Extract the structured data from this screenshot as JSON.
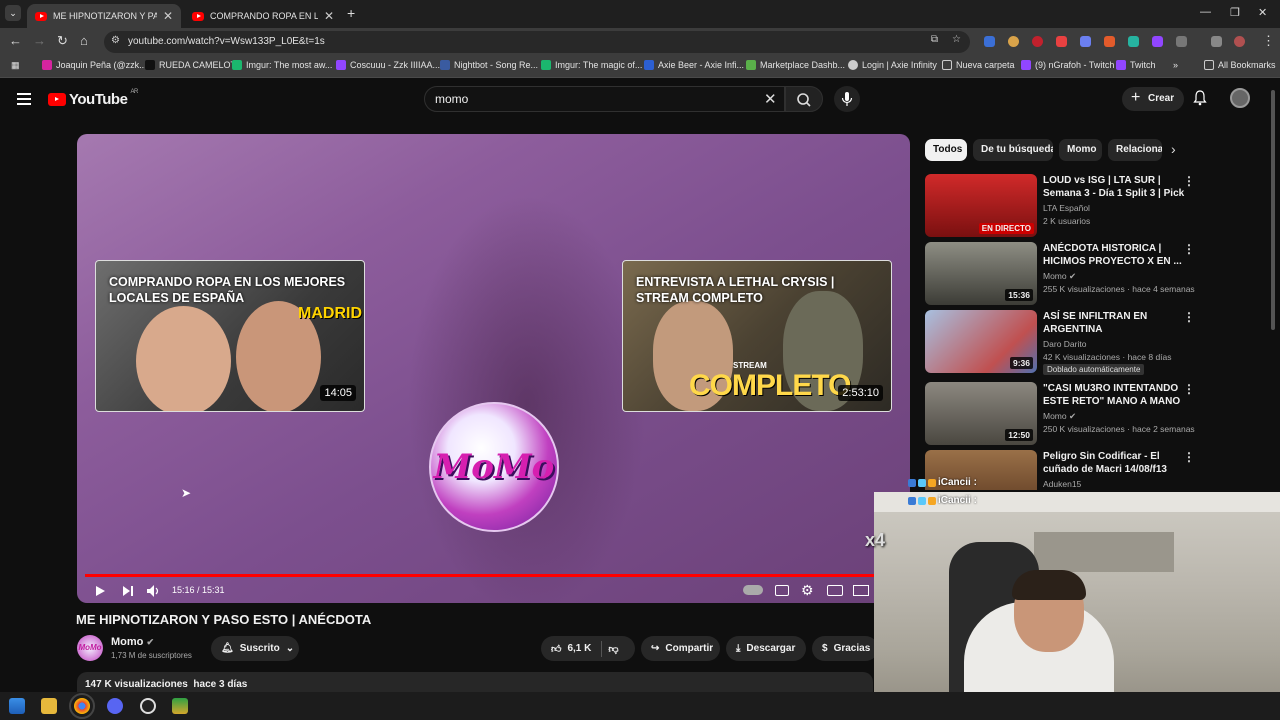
{
  "browser": {
    "tabs": [
      {
        "label": "ME HIPNOTIZARON Y PASO ESTO",
        "close": "✕"
      },
      {
        "label": "COMPRANDO ROPA EN LO",
        "close": "✕"
      }
    ],
    "new_tab": "+",
    "url": "youtube.com/watch?v=Wsw133P_L0E&t=1s",
    "bookmarks": [
      "Joaquin Peña (@zzk...",
      "RUEDA CAMELOT",
      "Imgur: The most aw...",
      "Coscuuu - Zzk IIIIAA...",
      "Nightbot - Song Re...",
      "Imgur: The magic of...",
      "Axie Beer - Axie Infi...",
      "Marketplace Dashb...",
      "Login | Axie Infinity",
      "Nueva carpeta",
      "(9) nGrafoh - Twitch",
      "Twitch"
    ],
    "all_bookmarks": "All Bookmarks"
  },
  "youtube": {
    "logo": "YouTube",
    "region": "AR",
    "search_value": "momo",
    "create": "Crear"
  },
  "player": {
    "end_cards": [
      {
        "title": "COMPRANDO ROPA EN LOS MEJORES LOCALES DE ESPAÑA",
        "badge": "MADRID",
        "duration": "14:05"
      },
      {
        "title": "ENTREVISTA A LETHAL CRYSIS | STREAM COMPLETO",
        "badge_top": "STREAM",
        "badge": "COMPLETO",
        "duration": "2:53:10"
      }
    ],
    "channel_mark": "MoMo",
    "time": "15:16 / 15:31",
    "progress": 0.983
  },
  "video": {
    "title": "ME HIPNOTIZARON Y PASO ESTO | ANÉCDOTA",
    "channel": "Momo",
    "subs": "1,73 M de suscriptores",
    "subscribed": "Suscrito",
    "likes": "6,1 K",
    "share": "Compartir",
    "download": "Descargar",
    "thanks": "Gracias",
    "views": "147 K visualizaciones",
    "date": "hace 3 días"
  },
  "chips": [
    "Todos",
    "De tu búsqueda",
    "Momo",
    "Relacionado"
  ],
  "recommendations": [
    {
      "title": "LOUD vs ISG | LTA SUR | Semana 3 - Día 1 Split 3 | Pick ...",
      "channel": "LTA Español",
      "meta": "2 K usuarios",
      "tag": "EN DIRECTO",
      "thumb": "#b51c1c"
    },
    {
      "title": "ANÉCDOTA HISTORICA | HICIMOS PROYECTO X EN ...",
      "channel": "Momo ✔",
      "meta": "255 K visualizaciones · hace 4 semanas",
      "duration": "15:36",
      "thumb": "#5a5a52"
    },
    {
      "title": "ASÍ SE INFILTRAN EN ARGENTINA",
      "channel": "Daro Darito",
      "meta": "42 K visualizaciones · hace 8 días",
      "dub": "Doblado automáticamente",
      "duration": "9:36",
      "thumb": "#8a9ab8"
    },
    {
      "title": "\"CASI MU3RO INTENTANDO ESTE RETO\" MANO A MANO ...",
      "channel": "Momo ✔",
      "meta": "250 K visualizaciones · hace 2 semanas",
      "duration": "12:50",
      "thumb": "#6e6a60"
    },
    {
      "title": "Peligro Sin Codificar - El cuñado de Macri 14/08/f13",
      "channel": "Aduken15",
      "meta": "",
      "thumb": "#7a5030"
    }
  ],
  "chat": [
    {
      "user": "iCancii :"
    },
    {
      "user": "iCancii :"
    }
  ],
  "overlay": "x4"
}
